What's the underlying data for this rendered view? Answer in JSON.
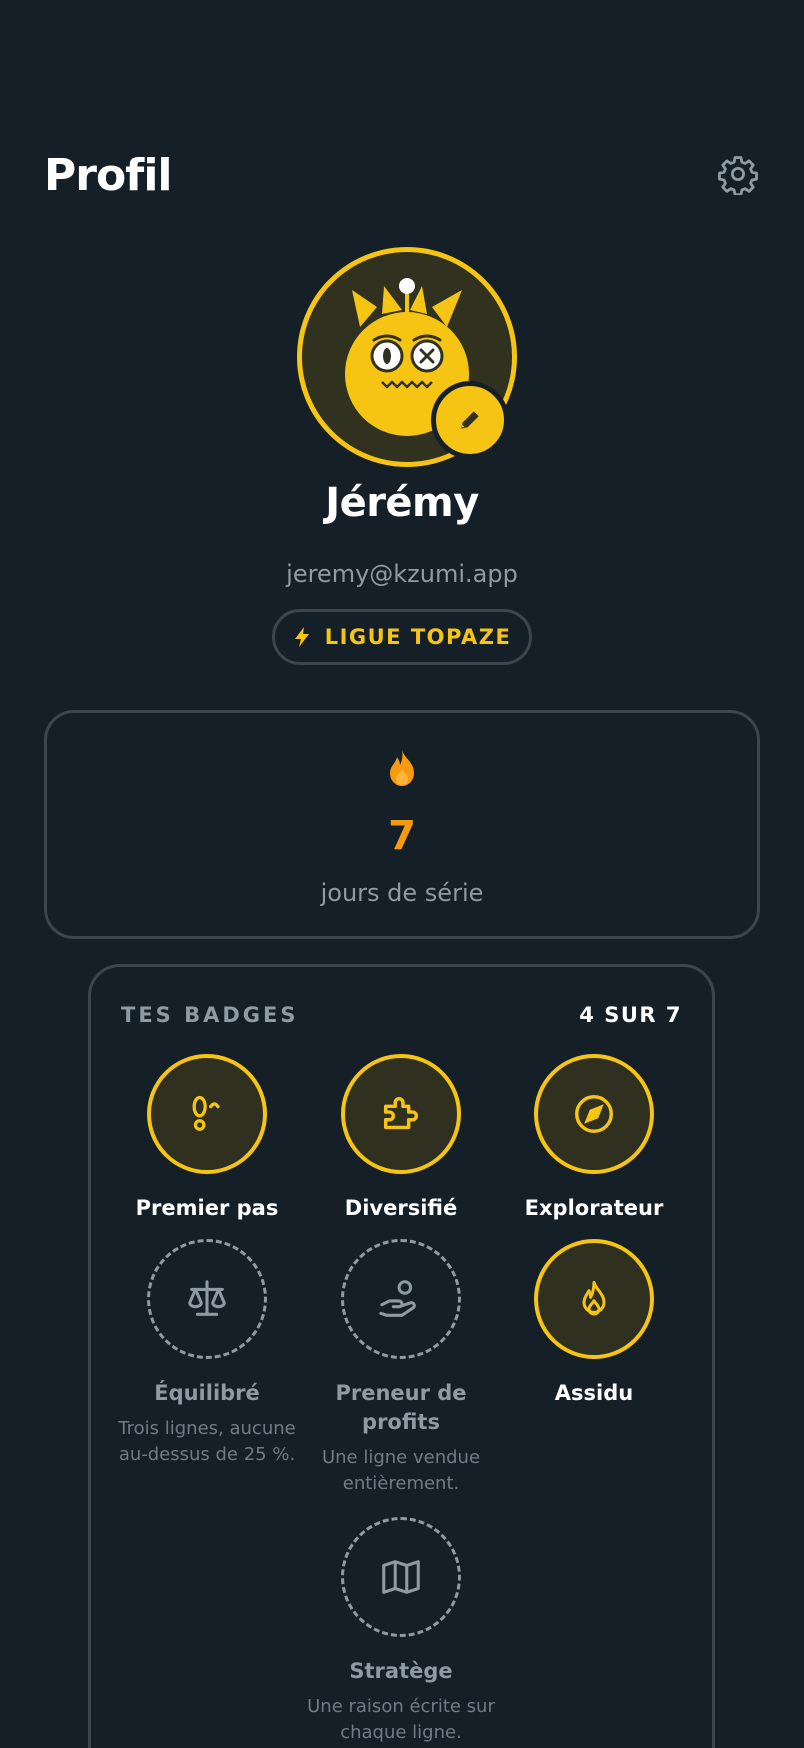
{
  "header": {
    "title": "Profil",
    "settings_icon": "gear-icon"
  },
  "profile": {
    "avatar_icon": "yellow-monster-avatar",
    "edit_icon": "pencil-icon",
    "name": "Jérémy",
    "email": "jeremy@kzumi.app",
    "league": {
      "icon": "lightning-icon",
      "label": "LIGUE TOPAZE"
    }
  },
  "streak": {
    "icon": "flame-icon",
    "value": "7",
    "label": "jours de série"
  },
  "badges": {
    "title": "TES BADGES",
    "count": "4 SUR 7",
    "items": [
      {
        "name": "Premier pas",
        "earned": true,
        "icon": "footprints-icon",
        "description": ""
      },
      {
        "name": "Diversifié",
        "earned": true,
        "icon": "puzzle-icon",
        "description": ""
      },
      {
        "name": "Explorateur",
        "earned": true,
        "icon": "compass-icon",
        "description": ""
      },
      {
        "name": "Équilibré",
        "earned": false,
        "icon": "scale-icon",
        "description": "Trois lignes, aucune au-dessus de 25 %."
      },
      {
        "name": "Preneur de profits",
        "earned": false,
        "icon": "hand-person-icon",
        "description": "Une ligne vendue entièrement."
      },
      {
        "name": "Assidu",
        "earned": true,
        "icon": "flame-icon",
        "description": ""
      },
      {
        "name": "Stratège",
        "earned": false,
        "icon": "map-icon",
        "description": "Une raison écrite sur chaque ligne."
      }
    ]
  },
  "colors": {
    "background": "#151f27",
    "accent": "#f6c513",
    "streak": "#f79a0e",
    "muted": "#8e9aa4",
    "border": "#3a4650"
  }
}
